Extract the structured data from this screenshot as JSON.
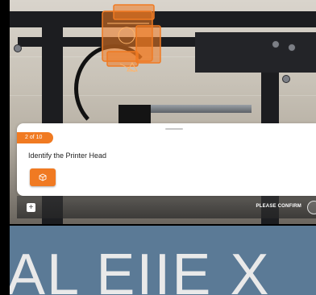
{
  "ar_step": {
    "step_label": "2 of 10",
    "instruction": "Identify the Printer Head"
  },
  "bottom_bar": {
    "confirm_label": "PLEASE CONFIRM",
    "add_label": "+"
  },
  "banner": {
    "text": "AL EIIE X"
  },
  "colors": {
    "accent": "#f07a22",
    "banner_bg": "#5b7a96"
  },
  "icons": [
    "printer-head-hologram-icon",
    "cube-icon",
    "plus-icon",
    "confirm-check-icon"
  ]
}
